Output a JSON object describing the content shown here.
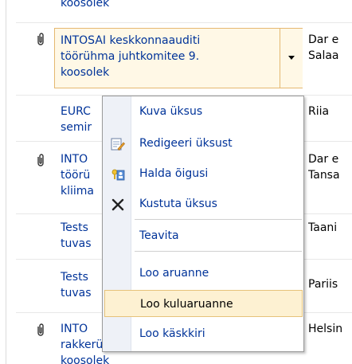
{
  "list": {
    "rows": [
      {
        "title": [
          "koosolek"
        ],
        "location": ""
      },
      {
        "title": [
          "INTOSAI keskkonnaauditi",
          "töörühma juhtkomitee 9.",
          "koosolek"
        ],
        "location": [
          "Dar e",
          "Salaa"
        ]
      },
      {
        "title": [
          "EURC",
          "semir"
        ],
        "location": [
          "Riia"
        ]
      },
      {
        "title": [
          "INTO",
          "töörü",
          "kliima"
        ],
        "location": [
          "Dar e",
          "Tansa"
        ]
      },
      {
        "title": [
          "Tests",
          "tuvas"
        ],
        "location": [
          "Taani"
        ]
      },
      {
        "title": [
          "Tests",
          "tuvas"
        ],
        "location": [
          "Pariis"
        ]
      },
      {
        "title": [
          "INTO",
          "rakkerühma aruannenüsjum",
          "koosolek"
        ],
        "location": [
          "Helsin"
        ]
      }
    ]
  },
  "menu": {
    "items": [
      {
        "label": "Kuva üksus",
        "icon": ""
      },
      {
        "label": "Redigeeri üksust",
        "icon": "edit-item-icon"
      },
      {
        "label": "Halda õigusi",
        "icon": "manage-permissions-icon"
      },
      {
        "label": "Kustuta üksus",
        "icon": "delete-x-icon"
      },
      {
        "label": "Teavita",
        "icon": ""
      },
      {
        "label": "Loo aruanne",
        "icon": ""
      },
      {
        "label": "Loo kuluaruanne",
        "icon": "",
        "highlighted": true
      },
      {
        "label": "Loo käskkiri",
        "icon": ""
      }
    ]
  },
  "colors": {
    "link": "#003399",
    "highlight_bg": "#fdf1d2",
    "highlight_border": "#e6c27a",
    "gutter": "#eef1f7"
  }
}
